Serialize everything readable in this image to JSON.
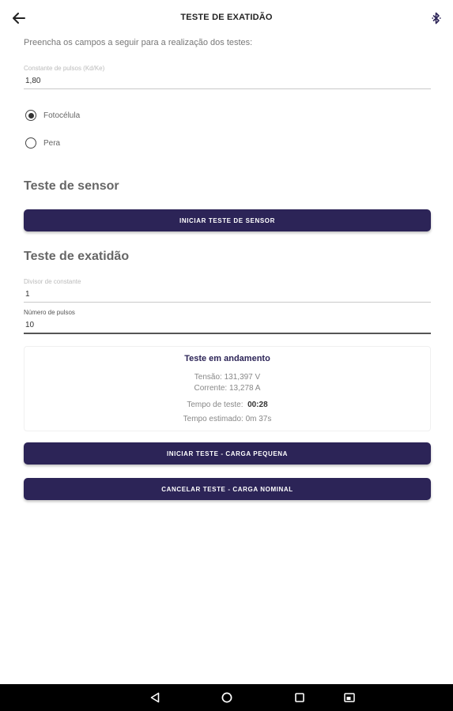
{
  "appbar": {
    "title": "TESTE DE EXATIDÃO",
    "back_icon": "arrow-left-icon",
    "bluetooth_icon": "bluetooth-icon"
  },
  "intro": "Preencha os campos a seguir para a realização dos testes:",
  "pulse_constant": {
    "label": "Constante de pulsos (Kd/Ke)",
    "value": "1,80"
  },
  "sensor_options": [
    {
      "label": "Fotocélula",
      "selected": true
    },
    {
      "label": "Pera",
      "selected": false
    }
  ],
  "sensor_section": {
    "title": "Teste de sensor",
    "start_button": "INICIAR TESTE DE SENSOR"
  },
  "accuracy_section": {
    "title": "Teste de exatidão",
    "divisor": {
      "label": "Divisor de constante",
      "value": "1"
    },
    "pulses": {
      "label": "Número de pulsos",
      "value": "10"
    }
  },
  "status_card": {
    "title": "Teste em andamento",
    "voltage": "Tensão: 131,397 V",
    "current": "Corrente: 13,278 A",
    "test_time_label": "Tempo de teste:",
    "test_time_value": "00:28",
    "estimated_time": "Tempo estimado: 0m 37s"
  },
  "buttons": {
    "start_small_load": "INICIAR TESTE - CARGA PEQUENA",
    "cancel_nominal_load": "CANCELAR TESTE - CARGA NOMINAL"
  },
  "colors": {
    "primary": "#2c2457",
    "nav_bar": "#000000"
  },
  "navbar": [
    "back-triangle-icon",
    "home-circle-icon",
    "recents-square-icon",
    "screenshot-icon"
  ]
}
